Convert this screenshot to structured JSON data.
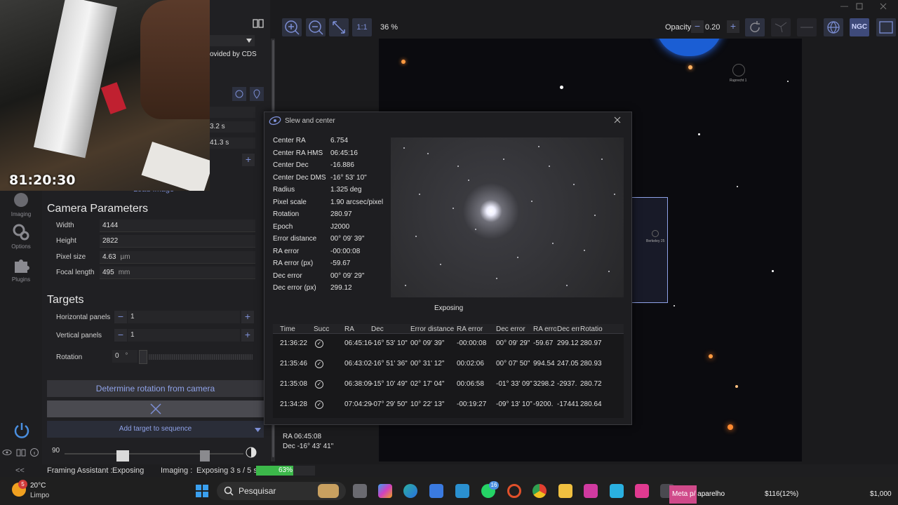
{
  "webcam": {
    "timer": "81:20:30"
  },
  "nav": {
    "items": [
      {
        "label": "Imaging",
        "icon": "camera-icon"
      },
      {
        "label": "Options",
        "icon": "gear-icon"
      },
      {
        "label": "Plugins",
        "icon": "puzzle-icon"
      }
    ]
  },
  "leftpanel": {
    "provided_by": "ovided by CDS",
    "hidden_vals": [
      "3.2 s",
      "41.3 s"
    ],
    "load_image": "Load Image",
    "camera_title": "Camera Parameters",
    "camera": [
      {
        "label": "Width",
        "value": "4144",
        "unit": ""
      },
      {
        "label": "Height",
        "value": "2822",
        "unit": ""
      },
      {
        "label": "Pixel size",
        "value": "4.63",
        "unit": "µm"
      },
      {
        "label": "Focal length",
        "value": "495",
        "unit": "mm"
      }
    ],
    "targets_title": "Targets",
    "horizontal_label": "Horizontal panels",
    "horizontal_value": "1",
    "vertical_label": "Vertical panels",
    "vertical_value": "1",
    "rotation_label": "Rotation",
    "rotation_value": "0",
    "rotation_unit": "°",
    "determine_rotation": "Determine rotation from camera",
    "add_target": "Add target to sequence",
    "scale_value": "90"
  },
  "toolbar": {
    "zoom_label": "1:1",
    "zoom_percent": "36 %",
    "opacity_label": "Opacity",
    "opacity_value": "0.20",
    "ngc_label": "NGC"
  },
  "sky": {
    "labels": [
      "Ruprecht 1",
      "Berkeley 25"
    ],
    "ra_label": "RA",
    "ra_value": "06:45:08",
    "dec_label": "Dec",
    "dec_value": "-16° 43' 41\""
  },
  "dialog": {
    "title": "Slew and center",
    "fields": [
      {
        "label": "Center RA",
        "value": "6.754"
      },
      {
        "label": "Center RA HMS",
        "value": "06:45:16"
      },
      {
        "label": "Center Dec",
        "value": "-16.886"
      },
      {
        "label": "Center Dec DMS",
        "value": "-16° 53' 10\""
      },
      {
        "label": "Radius",
        "value": "1.325 deg"
      },
      {
        "label": "Pixel scale",
        "value": "1.90 arcsec/pixel"
      },
      {
        "label": "Rotation",
        "value": "280.97"
      },
      {
        "label": "Epoch",
        "value": "J2000"
      },
      {
        "label": "Error distance",
        "value": "00° 09' 39\""
      },
      {
        "label": "RA error",
        "value": "-00:00:08"
      },
      {
        "label": "RA error (px)",
        "value": "-59.67"
      },
      {
        "label": "Dec error",
        "value": "00° 09' 29\""
      },
      {
        "label": "Dec error (px)",
        "value": "299.12"
      }
    ],
    "status": "Exposing",
    "columns": [
      "Time",
      "Succ",
      "RA",
      "Dec",
      "Error distance",
      "RA error",
      "Dec error",
      "RA erro",
      "Dec erro",
      "Rotatio"
    ],
    "rows": [
      [
        "21:36:22",
        "✓",
        "06:45:16",
        "-16° 53' 10\"",
        "00° 09' 39\"",
        "-00:00:08",
        "00° 09' 29\"",
        "-59.67",
        "299.12",
        "280.97"
      ],
      [
        "21:35:46",
        "✓",
        "06:43:02",
        "-16° 51' 36\"",
        "00° 31' 12\"",
        "00:02:06",
        "00° 07' 50\"",
        "994.54",
        "247.05",
        "280.93"
      ],
      [
        "21:35:08",
        "✓",
        "06:38:09",
        "-15° 10' 49\"",
        "02° 17' 04\"",
        "00:06:58",
        "-01° 33' 09\"",
        "3298.2",
        "-2937.",
        "280.72"
      ],
      [
        "21:34:28",
        "✓",
        "07:04:29",
        "-07° 29' 50\"",
        "10° 22' 13\"",
        "-00:19:27",
        "-09° 13' 10\"",
        "-9200.",
        "-17441",
        "280.64"
      ]
    ]
  },
  "statusbar": {
    "collapse": "<<",
    "framing": "Framing Assistant :",
    "framing_status": "Exposing",
    "imaging": "Imaging :",
    "imaging_status": "Exposing 3 s / 5 s",
    "progress_text": "63%",
    "progress": 0.63
  },
  "taskbar": {
    "weather_temp": "20°C",
    "weather_desc": "Limpo",
    "weather_badge": "5",
    "search": "Pesquisar",
    "whatsapp_badge": "16",
    "tooltip": "Meta p/ aparelho",
    "stock1": "$116(12%)",
    "stock2": "$1,000"
  },
  "colors": {
    "accent": "#7d8fd6",
    "progress": "#3cb84a"
  }
}
